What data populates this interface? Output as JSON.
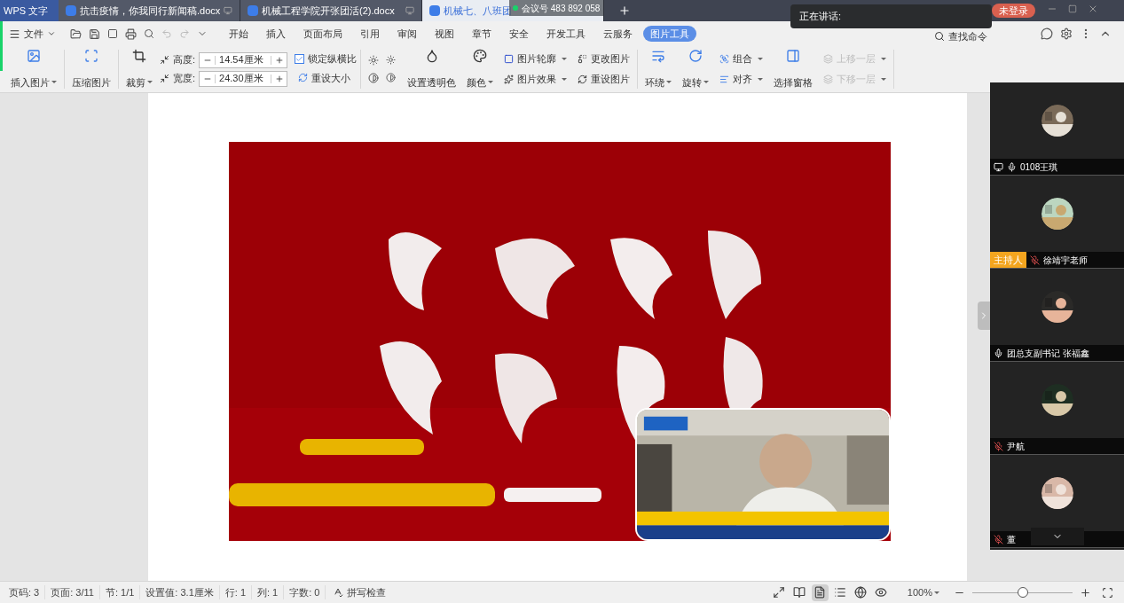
{
  "app_tab": {
    "label": "WPS 文字"
  },
  "doc_tabs": [
    {
      "label": "抗击疫情，你我同行新闻稿.docx",
      "selected": false
    },
    {
      "label": "机械工程学院开张团活(2).docx",
      "selected": false
    },
    {
      "label": "机械七、八班团",
      "selected": true
    }
  ],
  "meeting_id": "会议号 483 892 058",
  "login_button": "未登录",
  "speaking_popup": "正在讲话:",
  "file_menu": "文件",
  "menu_tabs": [
    {
      "label": "开始",
      "selected": false
    },
    {
      "label": "插入",
      "selected": false
    },
    {
      "label": "页面布局",
      "selected": false
    },
    {
      "label": "引用",
      "selected": false
    },
    {
      "label": "审阅",
      "selected": false
    },
    {
      "label": "视图",
      "selected": false
    },
    {
      "label": "章节",
      "selected": false
    },
    {
      "label": "安全",
      "selected": false
    },
    {
      "label": "开发工具",
      "selected": false
    },
    {
      "label": "云服务",
      "selected": false
    },
    {
      "label": "图片工具",
      "selected": true
    }
  ],
  "search_command": "查找命令",
  "ribbon": {
    "insert_picture": "插入图片",
    "compress_picture": "压缩图片",
    "crop": "裁剪",
    "height": {
      "label": "高度:",
      "value": "14.54厘米"
    },
    "width": {
      "label": "宽度:",
      "value": "24.30厘米"
    },
    "lock_ratio": {
      "label": "锁定纵横比",
      "checked": true
    },
    "reset_size": "重设大小",
    "transparent": "设置透明色",
    "color_button": "颜色",
    "outline": "图片轮廓",
    "effects": "图片效果",
    "change": "更改图片",
    "reset_picture": "重设图片",
    "wrap": "环绕",
    "rotate": "旋转",
    "group": "组合",
    "align": "对齐",
    "selection_pane": "选择窗格",
    "bring_forward": {
      "label": "上移一层",
      "disabled": true
    },
    "send_backward": {
      "label": "下移一层",
      "disabled": true
    }
  },
  "participants": [
    {
      "name": "0108王琪",
      "muted": false,
      "sharing": true
    },
    {
      "name": "徐靖宇老师",
      "muted": true,
      "sharing": false,
      "host_badge": "主持人"
    },
    {
      "name": "团总支副书记 张福鑫",
      "muted": false,
      "sharing": false
    },
    {
      "name": "尹航",
      "muted": true,
      "sharing": false
    },
    {
      "name": "董",
      "muted": true,
      "sharing": false
    }
  ],
  "status_bar": {
    "items": [
      "页码: 3",
      "页面: 3/11",
      "节: 1/1",
      "设置值: 3.1厘米",
      "行: 1",
      "列: 1",
      "字数: 0"
    ],
    "spell_check": "拼写检查",
    "view_modes": [
      {
        "kind": "fullscreen",
        "selected": false
      },
      {
        "kind": "reading",
        "selected": false
      },
      {
        "kind": "page",
        "selected": true
      },
      {
        "kind": "outline",
        "selected": false
      },
      {
        "kind": "web",
        "selected": false
      },
      {
        "kind": "eye",
        "selected": false
      }
    ],
    "zoom": "100%",
    "zoom_level": {
      "level": 0.5
    }
  }
}
